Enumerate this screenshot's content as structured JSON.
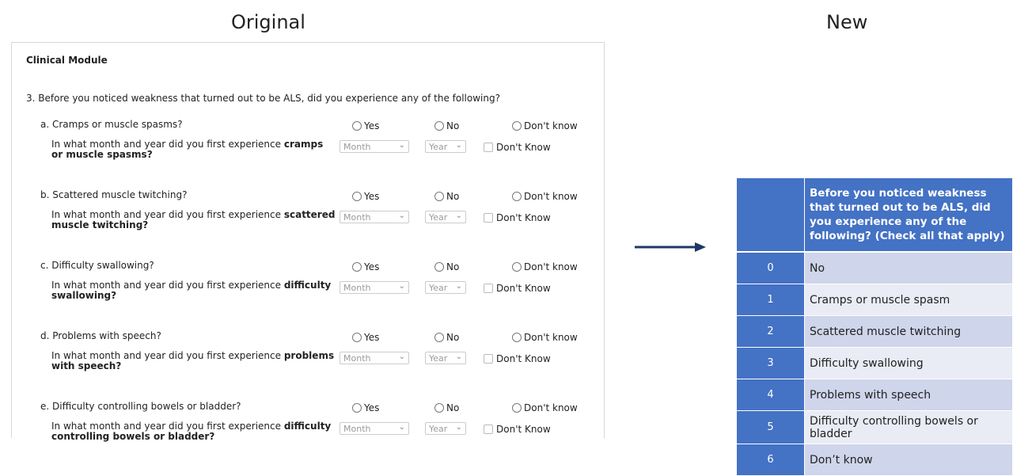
{
  "headings": {
    "original": "Original",
    "new": "New"
  },
  "original": {
    "module_title": "Clinical Module",
    "question": "3. Before you noticed weakness that turned out to be ALS, did you experience any of the following?",
    "options": {
      "yes": "Yes",
      "no": "No",
      "dont_know": "Don't know"
    },
    "followup_prefix": "In what month and year did you first experience",
    "month_placeholder": "Month",
    "year_placeholder": "Year",
    "dont_know_check": "Don't Know",
    "items": [
      {
        "label": "a. Cramps or muscle spasms?",
        "bold": "cramps or muscle spasms?"
      },
      {
        "label": "b. Scattered muscle twitching?",
        "bold": "scattered muscle twitching?"
      },
      {
        "label": "c. Difficulty swallowing?",
        "bold": "difficulty swallowing?"
      },
      {
        "label": "d. Problems with speech?",
        "bold": "problems with speech?"
      },
      {
        "label": "e. Difficulty controlling bowels or bladder?",
        "bold": "difficulty controlling bowels or bladder?"
      }
    ]
  },
  "new_table": {
    "header": "Before you noticed weakness that turned out to be ALS, did you experience any of the following? (Check all that apply)",
    "rows": [
      {
        "code": "0",
        "text": "No"
      },
      {
        "code": "1",
        "text": "Cramps or muscle spasm"
      },
      {
        "code": "2",
        "text": "Scattered muscle twitching"
      },
      {
        "code": "3",
        "text": "Difficulty swallowing"
      },
      {
        "code": "4",
        "text": "Problems with speech"
      },
      {
        "code": "5",
        "text": "Difficulty controlling bowels or bladder"
      },
      {
        "code": "6",
        "text": "Don’t know"
      }
    ]
  },
  "colors": {
    "header_blue": "#4472c4",
    "row_dark": "#cfd5ea",
    "row_light": "#e9ebf5",
    "arrow": "#1f3864"
  }
}
